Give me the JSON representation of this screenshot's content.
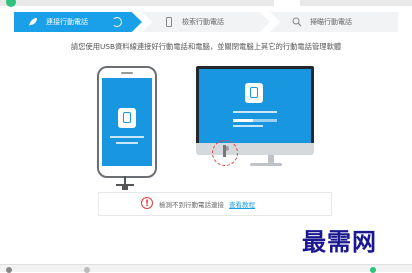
{
  "steps": [
    {
      "label": "連接行動電話",
      "icon": "leaf-icon",
      "state": "active"
    },
    {
      "label": "檢索行動電話",
      "icon": "phone-outline-icon",
      "state": "pending"
    },
    {
      "label": "掃瞄行動電話",
      "icon": "search-icon",
      "state": "pending"
    }
  ],
  "instruction": "請您使用USB資料線連接好行動電話和電腦，並關閉電腦上其它的行動電話管理軟體",
  "status": {
    "message": "檢測不到行動電話連接",
    "help_link": "查看教程",
    "warning_color": "#e23b3b"
  },
  "watermark": "最需网",
  "colors": {
    "accent": "#1aa0e8",
    "screen": "#1896e0"
  }
}
